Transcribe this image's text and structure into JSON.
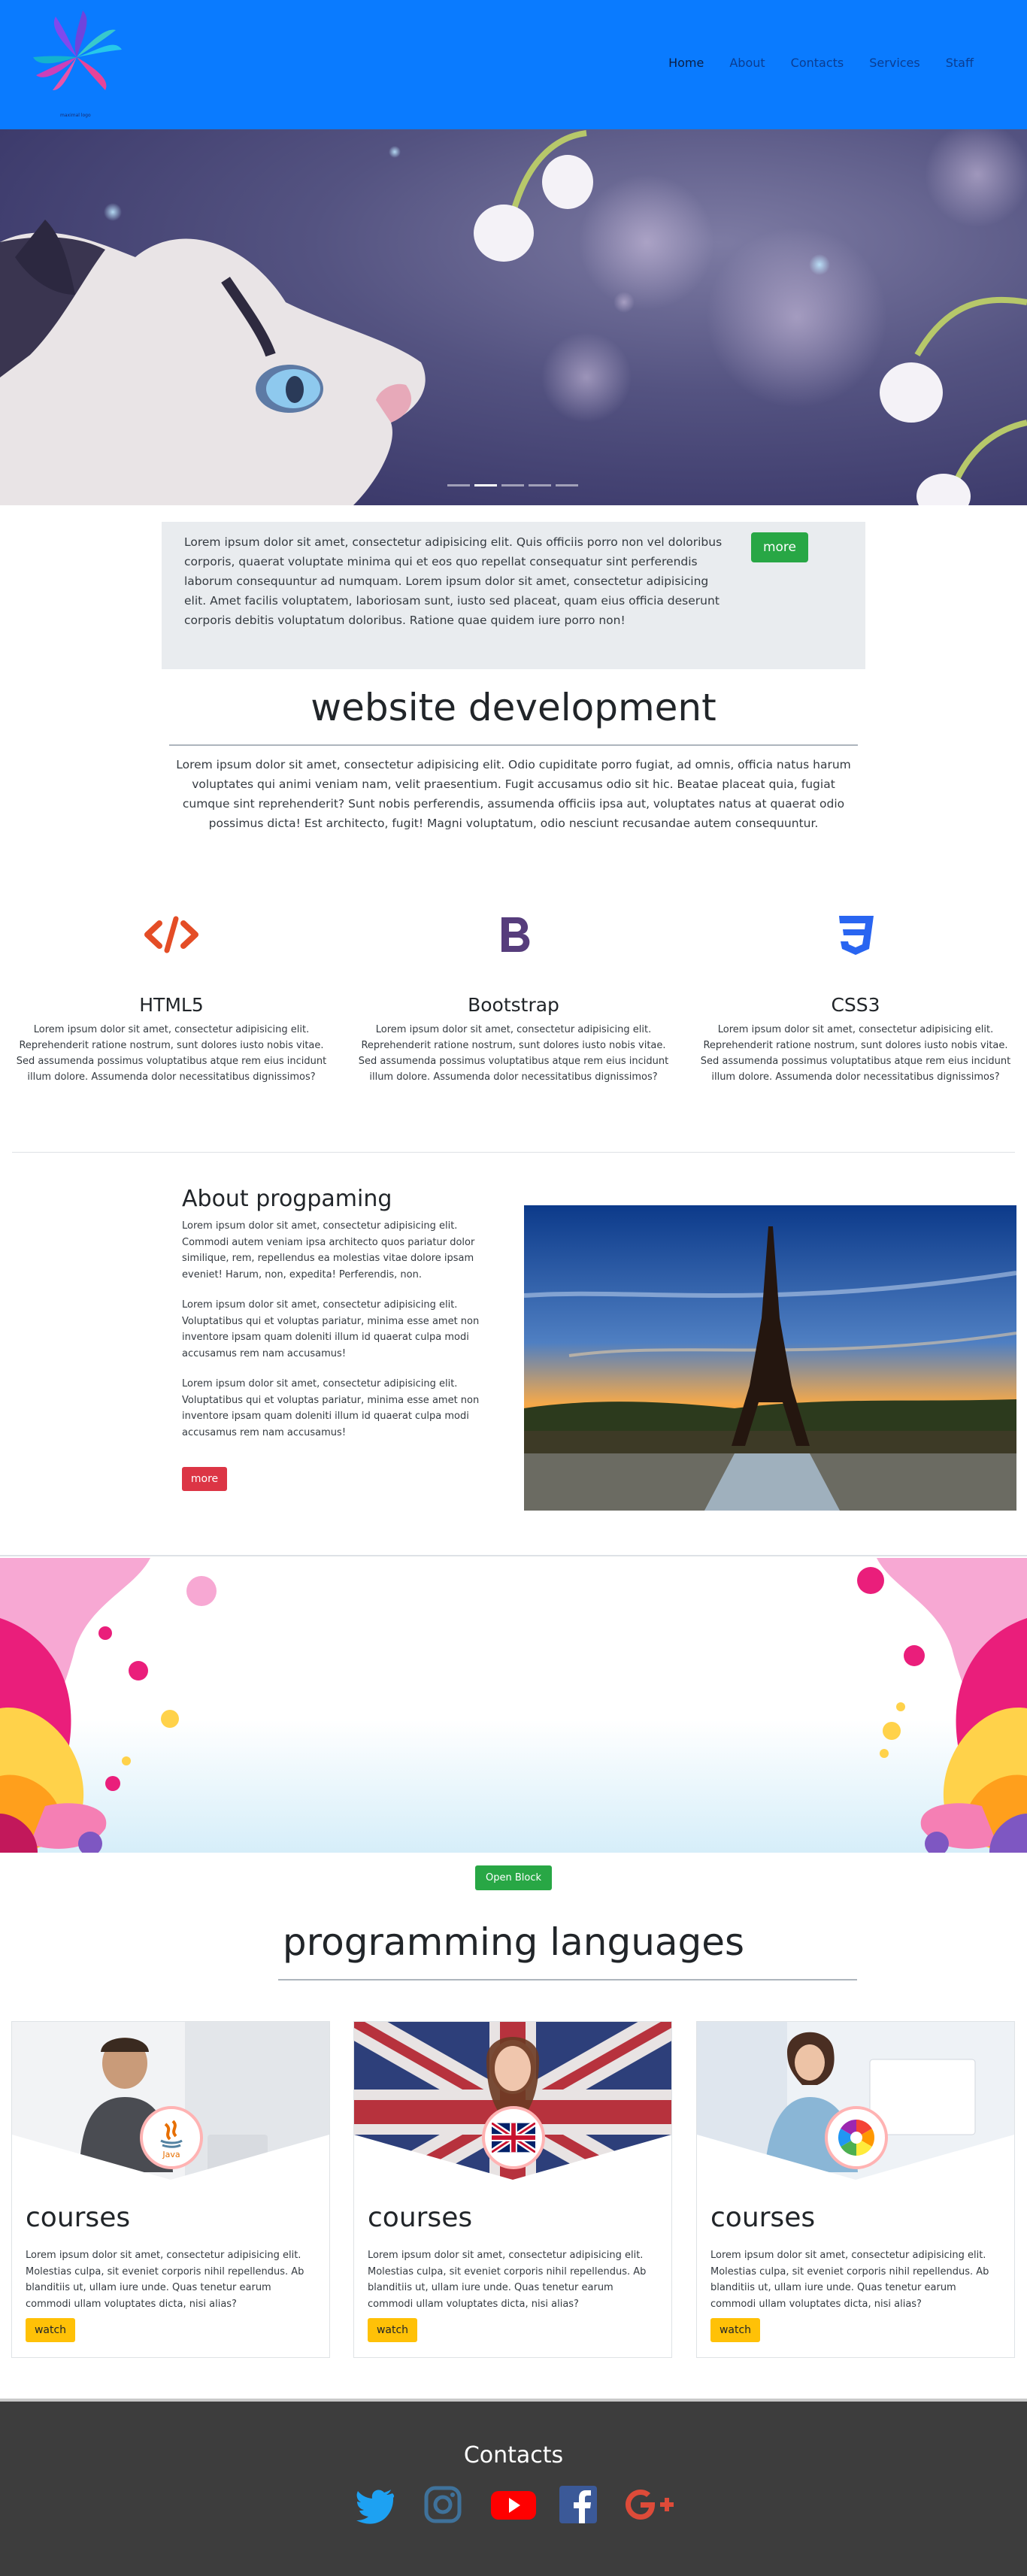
{
  "nav": {
    "logo_caption": "maximal logo",
    "items": [
      {
        "label": "Home",
        "active": true
      },
      {
        "label": "About"
      },
      {
        "label": "Contacts"
      },
      {
        "label": "Services"
      },
      {
        "label": "Staff"
      }
    ]
  },
  "hero": {
    "slides": 5,
    "active_slide": 2
  },
  "intro": {
    "text": "Lorem ipsum dolor sit amet, consectetur adipisicing elit. Quis officiis porro non vel doloribus corporis, quaerat voluptate minima qui et eos quo repellat consequatur sint perferendis laborum consequuntur ad numquam. Lorem ipsum dolor sit amet, consectetur adipisicing elit. Amet facilis voluptatem, laboriosam sunt, iusto sed placeat, quam eius officia deserunt corporis debitis voluptatum doloribus. Ratione quae quidem iure porro non!",
    "button": "more"
  },
  "webdev": {
    "title": "website development",
    "text": "Lorem ipsum dolor sit amet, consectetur adipisicing elit. Odio cupiditate porro fugiat, ad omnis, officia natus harum voluptates qui animi veniam nam, velit praesentium. Fugit accusamus odio sit hic. Beatae placeat quia, fugiat cumque sint reprehenderit? Sunt nobis perferendis, assumenda officiis ipsa aut, voluptates natus at quaerat odio possimus dicta! Est architecto, fugit! Magni voluptatum, odio nesciunt recusandae autem consequuntur.",
    "techs": [
      {
        "name": "HTML5",
        "icon": "html-code-icon",
        "color": "#e44d26",
        "text": "Lorem ipsum dolor sit amet, consectetur adipisicing elit. Reprehenderit ratione nostrum, sunt dolores iusto nobis vitae. Sed assumenda possimus voluptatibus atque rem eius incidunt illum dolore. Assumenda dolor necessitatibus dignissimos?"
      },
      {
        "name": "Bootstrap",
        "icon": "bootstrap-icon",
        "color": "#563d7c",
        "text": "Lorem ipsum dolor sit amet, consectetur adipisicing elit. Reprehenderit ratione nostrum, sunt dolores iusto nobis vitae. Sed assumenda possimus voluptatibus atque rem eius incidunt illum dolore. Assumenda dolor necessitatibus dignissimos?"
      },
      {
        "name": "CSS3",
        "icon": "css3-icon",
        "color": "#2965f1",
        "text": "Lorem ipsum dolor sit amet, consectetur adipisicing elit. Reprehenderit ratione nostrum, sunt dolores iusto nobis vitae. Sed assumenda possimus voluptatibus atque rem eius incidunt illum dolore. Assumenda dolor necessitatibus dignissimos?"
      }
    ]
  },
  "about": {
    "title": "About progpaming",
    "paragraphs": [
      "Lorem ipsum dolor sit amet, consectetur adipisicing elit. Commodi autem veniam ipsa architecto quos pariatur dolor similique, rem, repellendus ea molestias vitae dolore ipsam eveniet! Harum, non, expedita! Perferendis, non.",
      "Lorem ipsum dolor sit amet, consectetur adipisicing elit. Voluptatibus qui et voluptas pariatur, minima esse amet non inventore ipsam quam doleniti illum id quaerat culpa modi accusamus rem nam accusamus!",
      "Lorem ipsum dolor sit amet, consectetur adipisicing elit. Voluptatibus qui et voluptas pariatur, minima esse amet non inventore ipsam quam doleniti illum id quaerat culpa modi accusamus rem nam accusamus!"
    ],
    "button": "more"
  },
  "splash": {
    "button": "Open Block"
  },
  "programming": {
    "title": "programming languages",
    "cards": [
      {
        "title": "courses",
        "text": "Lorem ipsum dolor sit amet, consectetur adipisicing elit. Molestias culpa, sit eveniet corporis nihil repellendus. Ab blanditiis ut, ullam iure unde. Quas tenetur earum commodi ullam voluptates dicta, nisi alias?",
        "button": "watch",
        "badge_icon": "java-logo-icon",
        "badge_label": "Java"
      },
      {
        "title": "courses",
        "text": "Lorem ipsum dolor sit amet, consectetur adipisicing elit. Molestias culpa, sit eveniet corporis nihil repellendus. Ab blanditiis ut, ullam iure unde. Quas tenetur earum commodi ullam voluptates dicta, nisi alias?",
        "button": "watch",
        "badge_icon": "uk-flag-icon"
      },
      {
        "title": "courses",
        "text": "Lorem ipsum dolor sit amet, consectetur adipisicing elit. Molestias culpa, sit eveniet corporis nihil repellendus. Ab blanditiis ut, ullam iure unde. Quas tenetur earum commodi ullam voluptates dicta, nisi alias?",
        "button": "watch",
        "badge_icon": "color-wheel-icon"
      }
    ]
  },
  "footer": {
    "title": "Contacts",
    "socials": [
      {
        "icon": "twitter-icon",
        "color": "#1da1f2"
      },
      {
        "icon": "instagram-icon",
        "color": "#3f729b"
      },
      {
        "icon": "youtube-icon",
        "color": "#ff0000"
      },
      {
        "icon": "facebook-icon",
        "color": "#3b5998"
      },
      {
        "icon": "google-plus-icon",
        "color": "#dd4b39"
      }
    ]
  }
}
